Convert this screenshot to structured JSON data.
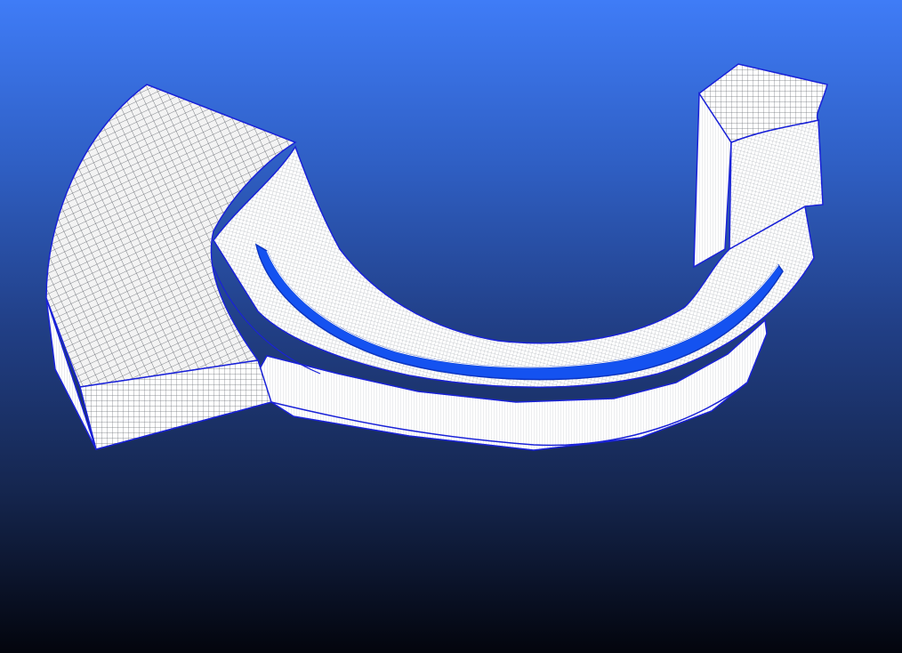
{
  "scene": {
    "background_top": "#3f7cf7",
    "background_bottom": "#03050d",
    "mesh_line_color": "#ffffff",
    "mesh_face_color": "#f2f4f8",
    "mesh_shadow_color": "#8c9097",
    "edge_color": "#1a22d8",
    "channel_color": "#1452f0"
  }
}
